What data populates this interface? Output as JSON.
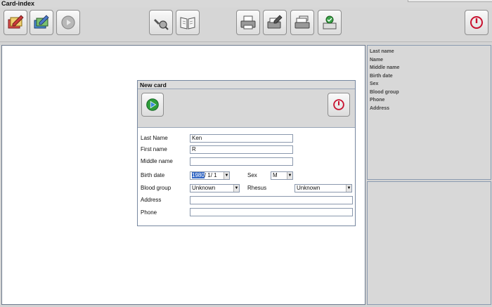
{
  "window": {
    "title": "Card-index"
  },
  "toolbar": {
    "buttons": [
      {
        "id": "new",
        "icon": "pencil-card-icon"
      },
      {
        "id": "edit",
        "icon": "edit-cards-icon"
      },
      {
        "id": "play",
        "icon": "play-disabled-icon"
      },
      {
        "id": "search",
        "icon": "search-icon"
      },
      {
        "id": "book",
        "icon": "open-book-icon"
      },
      {
        "id": "print",
        "icon": "printer-icon"
      },
      {
        "id": "print-edit",
        "icon": "print-edit-icon"
      },
      {
        "id": "print-multi",
        "icon": "multi-printer-icon"
      },
      {
        "id": "export",
        "icon": "export-icon"
      },
      {
        "id": "exit",
        "icon": "power-icon"
      }
    ]
  },
  "info_panel": {
    "labels": [
      "Last name",
      "Name",
      "Middle name",
      "Birth date",
      "Sex",
      "Blood group",
      "Phone",
      "Address"
    ]
  },
  "dialog": {
    "title": "New card",
    "fields": {
      "last_name_label": "Last Name",
      "last_name": "Ken",
      "first_name_label": "First name",
      "first_name": "R",
      "middle_name_label": "Middle name",
      "middle_name": "",
      "birth_date_label": "Birth date",
      "birth_year": "1980",
      "birth_rest": "/  1/  1",
      "sex_label": "Sex",
      "sex": "M",
      "blood_group_label": "Blood group",
      "blood_group": "Unknown",
      "rhesus_label": "Rhesus",
      "rhesus": "Unknown",
      "address_label": "Address",
      "address": "",
      "phone_label": "Phone",
      "phone": ""
    }
  },
  "colors": {
    "accent_red": "#c8102e",
    "accent_green": "#2e9e3a",
    "selection": "#3166c4"
  }
}
